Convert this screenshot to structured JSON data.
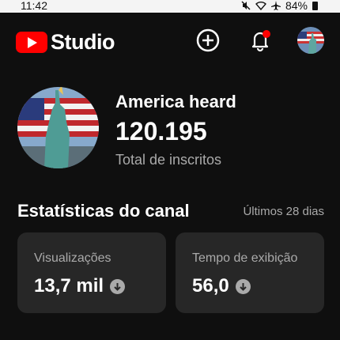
{
  "status_bar": {
    "time": "11:42",
    "battery": "84%",
    "icons": [
      "mute-icon",
      "wifi-icon",
      "airplane-icon",
      "battery-icon"
    ]
  },
  "app_bar": {
    "logo_text": "Studio",
    "brand_color": "#ff0000",
    "notification_dot_color": "#ff0000",
    "actions": [
      "create-icon",
      "bell-icon",
      "avatar"
    ]
  },
  "channel": {
    "name": "America heard",
    "subscriber_count": "120.195",
    "subscriber_label": "Total de inscritos"
  },
  "stats": {
    "title": "Estatísticas do canal",
    "period": "Últimos 28 dias",
    "cards": [
      {
        "label": "Visualizações",
        "value": "13,7 mil",
        "trend_icon": "arrow-down-icon"
      },
      {
        "label": "Tempo de exibição",
        "value": "56,0",
        "trend_icon": "arrow-down-icon"
      }
    ]
  }
}
